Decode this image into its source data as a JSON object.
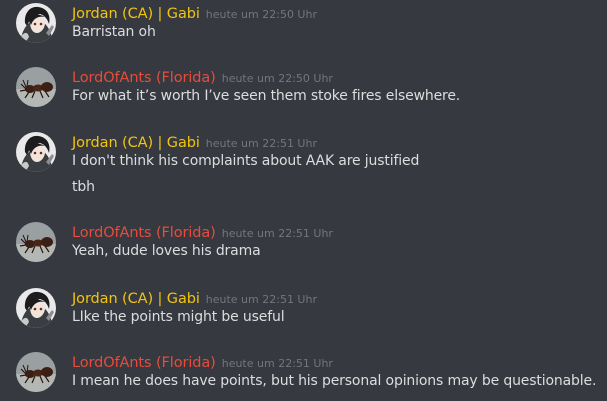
{
  "colors": {
    "background": "#36393f",
    "message_text": "#dcddde",
    "timestamp": "#72767d",
    "jordan_name": "#f1c40f",
    "lord_name": "#e74c3c"
  },
  "messages": [
    {
      "author": "Jordan (CA) | Gabi",
      "avatar": "anime-character-avatar",
      "time": "heute um 22:50 Uhr",
      "lines": [
        "Barristan oh"
      ]
    },
    {
      "author": "LordOfAnts (Florida)",
      "avatar": "ant-avatar",
      "time": "heute um 22:50 Uhr",
      "lines": [
        "For what it’s worth I’ve seen them stoke fires elsewhere."
      ]
    },
    {
      "author": "Jordan (CA) | Gabi",
      "avatar": "anime-character-avatar",
      "time": "heute um 22:51 Uhr",
      "lines": [
        "I don't think his complaints about AAK are justified",
        "tbh"
      ]
    },
    {
      "author": "LordOfAnts (Florida)",
      "avatar": "ant-avatar",
      "time": "heute um 22:51 Uhr",
      "lines": [
        "Yeah, dude loves his drama"
      ]
    },
    {
      "author": "Jordan (CA) | Gabi",
      "avatar": "anime-character-avatar",
      "time": "heute um 22:51 Uhr",
      "lines": [
        "LIke the points might be useful"
      ]
    },
    {
      "author": "LordOfAnts (Florida)",
      "avatar": "ant-avatar",
      "time": "heute um 22:51 Uhr",
      "lines": [
        "I mean he does have points, but his personal opinions may be questionable."
      ]
    }
  ]
}
